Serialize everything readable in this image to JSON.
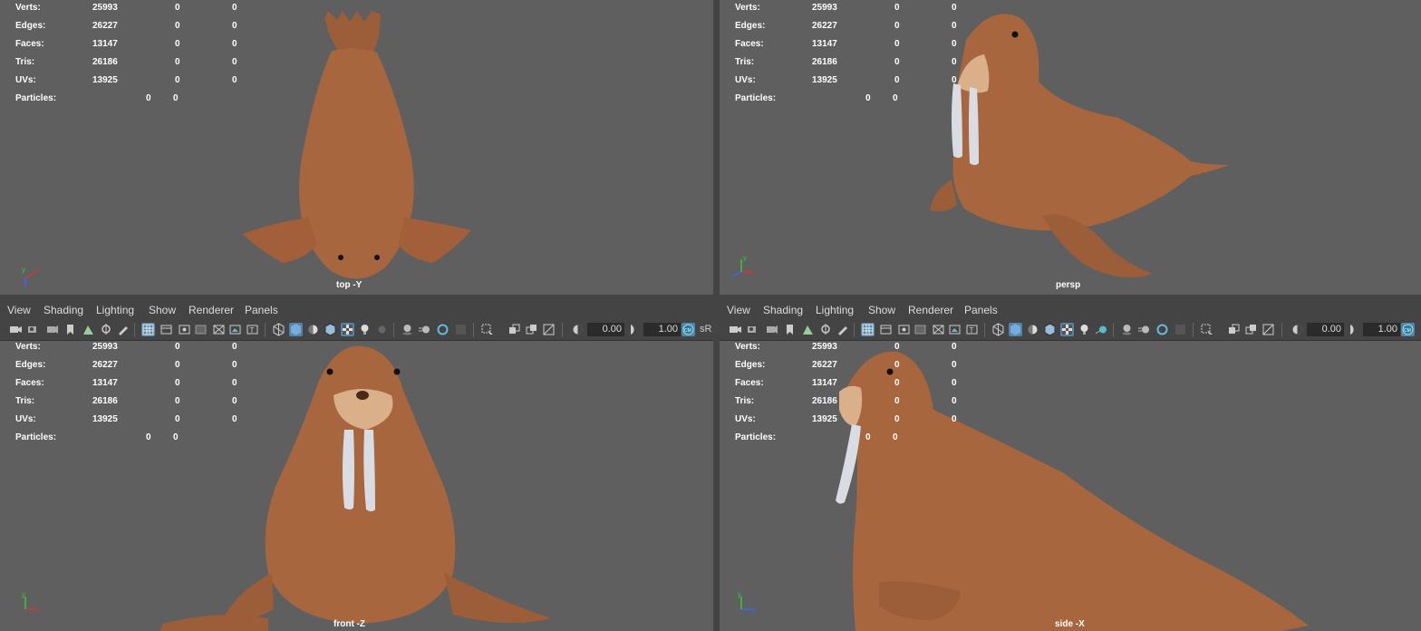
{
  "menu": {
    "view": "View",
    "shading": "Shading",
    "lighting": "Lighting",
    "show": "Show",
    "renderer": "Renderer",
    "panels": "Panels"
  },
  "toolbar": {
    "exposure": "0.00",
    "gamma": "1.00",
    "colorspace_abbrev": "sR"
  },
  "hud_labels": {
    "verts": "Verts:",
    "edges": "Edges:",
    "faces": "Faces:",
    "tris": "Tris:",
    "uvs": "UVs:",
    "particles": "Particles:"
  },
  "hud_values": {
    "verts": [
      "25993",
      "0",
      "0"
    ],
    "edges": [
      "26227",
      "0",
      "0"
    ],
    "faces": [
      "13147",
      "0",
      "0"
    ],
    "tris": [
      "26186",
      "0",
      "0"
    ],
    "uvs": [
      "13925",
      "0",
      "0"
    ],
    "particles": [
      "0",
      "0"
    ]
  },
  "cameras": {
    "top": "top -Y",
    "persp": "persp",
    "front": "front -Z",
    "side": "side -X"
  },
  "axis": {
    "x": "x",
    "y": "y",
    "z": "z"
  },
  "colors": {
    "viewport_bg": "#5f5f5f",
    "ui_bg": "#444444",
    "active_icon": "#5285a6",
    "walrus_skin": "#a8663f",
    "tusk": "#d9dde3"
  }
}
